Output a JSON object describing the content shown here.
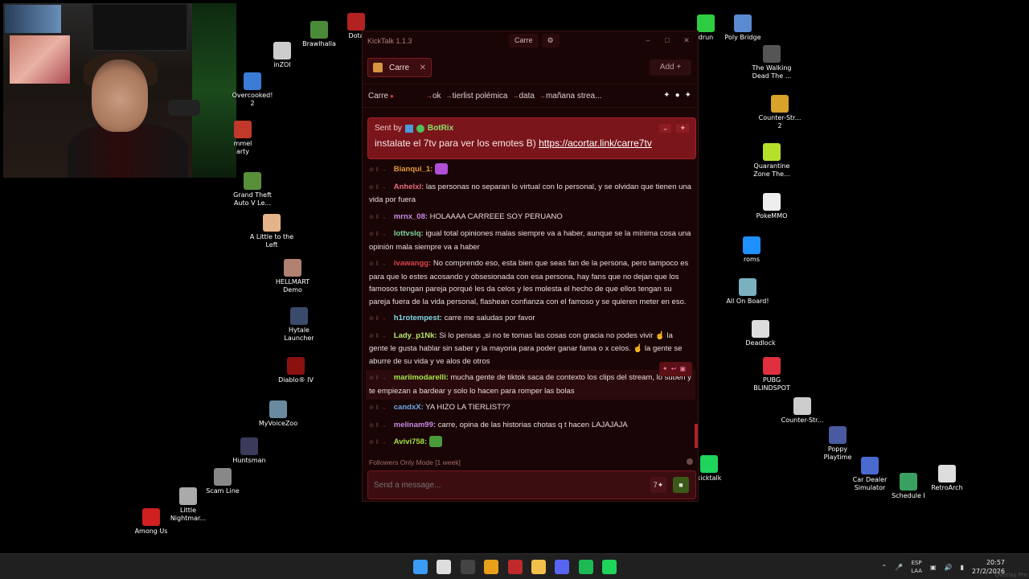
{
  "desktop_icons": [
    {
      "label": "Brawlhalla",
      "color": "#4a8b3a"
    },
    {
      "label": "Dota",
      "color": "#b22222"
    },
    {
      "label": "inZOI",
      "color": "#cccccc"
    },
    {
      "label": "Overcooked!\n2",
      "color": "#3a7bd5"
    },
    {
      "label": "mmel\narty",
      "color": "#c0392b"
    },
    {
      "label": "Grand Theft\nAuto V Le...",
      "color": "#5a8f3a"
    },
    {
      "label": "A Little to the\nLeft",
      "color": "#e5b38a"
    },
    {
      "label": "HELLMART\nDemo",
      "color": "#b08070"
    },
    {
      "label": "Hytale\nLauncher",
      "color": "#3a4a6a"
    },
    {
      "label": "Diablo® IV",
      "color": "#8b1010"
    },
    {
      "label": "MyVoiceZoo",
      "color": "#6a8aa0"
    },
    {
      "label": "Huntsman",
      "color": "#3a3a5a"
    },
    {
      "label": "Scam Line",
      "color": "#888888"
    },
    {
      "label": "Little\nNightmar...",
      "color": "#aaaaaa"
    },
    {
      "label": "Among Us",
      "color": "#d02020"
    },
    {
      "label": "drun",
      "color": "#2ecc40"
    },
    {
      "label": "Poly Bridge",
      "color": "#5a8ad0"
    },
    {
      "label": "The Walking\nDead The ...",
      "color": "#555555"
    },
    {
      "label": "Counter-Str...\n2",
      "color": "#d9a22a"
    },
    {
      "label": "Quarantine\nZone The...",
      "color": "#b5e02a"
    },
    {
      "label": "PokeMMO",
      "color": "#eeeeee"
    },
    {
      "label": "roms",
      "color": "#1e90ff"
    },
    {
      "label": "All On Board!",
      "color": "#7ab0c0"
    },
    {
      "label": "Deadlock",
      "color": "#dddddd"
    },
    {
      "label": "PUBG\nBLINDSPOT",
      "color": "#e03040"
    },
    {
      "label": "Counter-Str...",
      "color": "#cccccc"
    },
    {
      "label": "Poppy\nPlaytime",
      "color": "#4a5aa0"
    },
    {
      "label": "kicktalk",
      "color": "#1fd45a"
    },
    {
      "label": "Car Dealer\nSimulator",
      "color": "#4a6ad0"
    },
    {
      "label": "Schedule I",
      "color": "#3aa060"
    },
    {
      "label": "RetroArch",
      "color": "#dddddd"
    }
  ],
  "window": {
    "title": "KickTalk 1.1.3",
    "center_tab": "Carre",
    "controls": {
      "minimize": "–",
      "maximize": "□",
      "close": "✕"
    },
    "tab": {
      "label": "Carre",
      "close": "✕"
    },
    "add_button": "Add  +",
    "channel": {
      "name": "Carre",
      "keywords": [
        "ok",
        "tierlist polémica",
        "data",
        "mañana strea..."
      ]
    },
    "pinned": {
      "sent_by": "Sent by",
      "bot_name": "BotRix",
      "message": "instalate el 7tv para ver los emotes B) ",
      "link": "https://acortar.link/carre7tv"
    },
    "messages": [
      {
        "user": "Bianqui_1:",
        "color": "#e39a3a",
        "text": "",
        "emote": "#b04fd6"
      },
      {
        "user": "Anhelxl:",
        "color": "#e86b7a",
        "text": "las personas no separan lo virtual con lo personal, y se olvidan que tienen una vida por fuera"
      },
      {
        "user": "mrnx_08:",
        "color": "#c78ee8",
        "text": "HOLAAAA CARREEE SOY PERUANO"
      },
      {
        "user": "lottvslq:",
        "color": "#7ed3a0",
        "text": "igual total opiniones malas siempre va a haber, aunque se la mínima cosa una opinión mala siempre va a haber"
      },
      {
        "user": "ivawangg:",
        "color": "#d8464a",
        "text": "No comprendo eso, esta bien que seas fan de la persona, pero tampoco es para que lo estes acosando y obsesionada con esa persona, hay fans que no dejan que los famosos tengan pareja porqué les da celos y les molesta el hecho de que ellos tengan su pareja fuera de la vida personal, flashean confianza con el famoso y se quieren meter en eso."
      },
      {
        "user": "h1rotempest:",
        "color": "#7fd9e8",
        "text": "carre me saludas por favor"
      },
      {
        "user": "Lady_p1Nk:",
        "color": "#b6e86b",
        "text": "Si lo pensas ,si no te tomas las cosas con gracia no podes vivir ☝️ la gente le gusta hablar sin saber y la mayoria para poder ganar fama o x celos. ☝️ la gente se aburre de su vida y ve alos de otros"
      },
      {
        "user": "mariimodarelli:",
        "color": "#a8e84a",
        "text": "mucha gente de tiktok saca de contexto los clips del stream, lo suben y te empiezan a bardear y solo lo hacen para romper las bolas",
        "hover": true
      },
      {
        "user": "candxX:",
        "color": "#6aa8e8",
        "text": "YA HIZO LA TIERLIST??"
      },
      {
        "user": "melinam99:",
        "color": "#c88ae0",
        "text": "carre, opina de las historias chotas q t hacen LAJAJAJA"
      },
      {
        "user": "Avivi758:",
        "color": "#a0e04a",
        "text": "",
        "emote": "#4a9a3a"
      }
    ],
    "status": "Followers Only Mode [1 week]",
    "input_placeholder": "Send a message..."
  },
  "taskbar": {
    "icons": [
      {
        "name": "windows-start-icon",
        "color": "#3a9cf5"
      },
      {
        "name": "search-icon",
        "color": "#dddddd"
      },
      {
        "name": "obs-icon",
        "color": "#444444"
      },
      {
        "name": "chrome-icon",
        "color": "#e8a01a"
      },
      {
        "name": "dazzle-icon",
        "color": "#c02a2a"
      },
      {
        "name": "file-explorer-icon",
        "color": "#f2c04a"
      },
      {
        "name": "discord-icon",
        "color": "#5865f2"
      },
      {
        "name": "spotify-icon",
        "color": "#1db954"
      },
      {
        "name": "kicktalk-icon",
        "color": "#1fd45a"
      }
    ],
    "lang": "ESP\nLAA",
    "time": "20:57",
    "date": "27/2/2026",
    "overlay": "Overlay Pro"
  }
}
